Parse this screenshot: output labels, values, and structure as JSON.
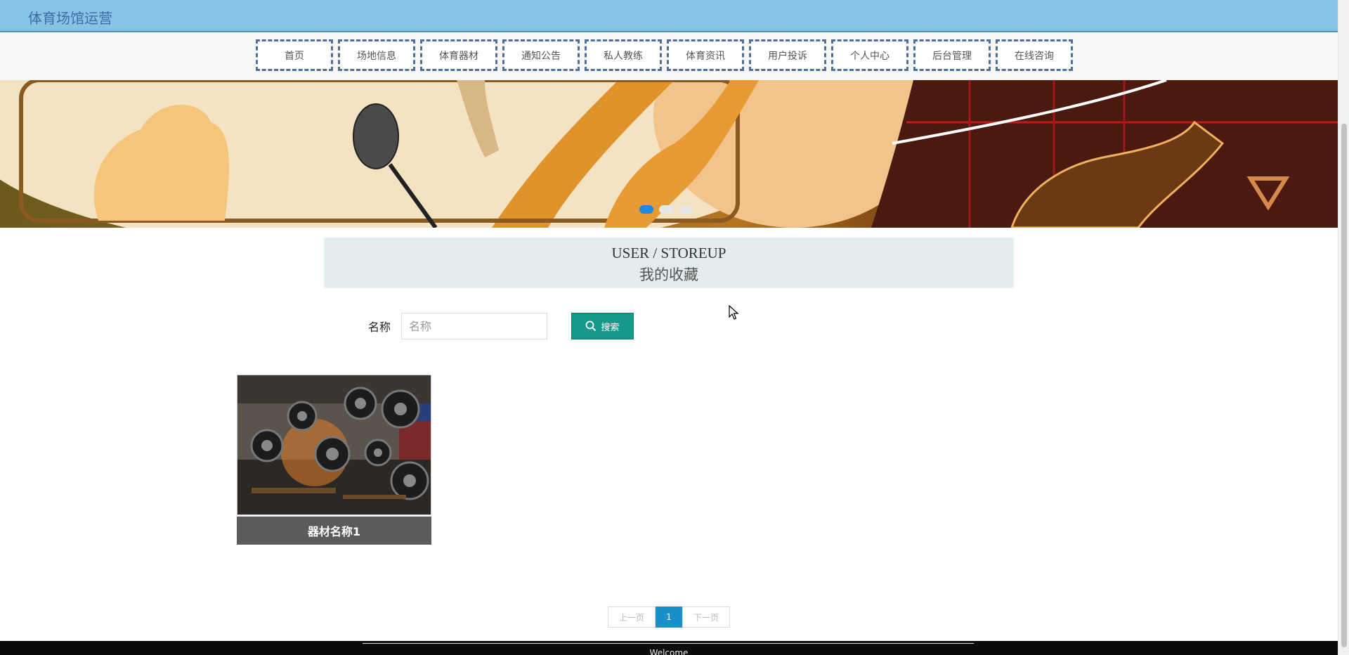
{
  "header": {
    "brand": "体育场馆运营"
  },
  "nav": {
    "items": [
      "首页",
      "场地信息",
      "体育器材",
      "通知公告",
      "私人教练",
      "体育资讯",
      "用户投诉",
      "个人中心",
      "后台管理",
      "在线咨询"
    ]
  },
  "banner": {
    "active_slide": 1,
    "slide_count": 3
  },
  "page_title": {
    "en": "USER / STOREUP",
    "cn": "我的收藏"
  },
  "search": {
    "label": "名称",
    "placeholder": "名称",
    "value": "",
    "button_label": "搜索"
  },
  "cards": [
    {
      "title": "器材名称1"
    }
  ],
  "pagination": {
    "prev": "上一页",
    "current": "1",
    "next": "下一页"
  },
  "footer": {
    "text": "Welcome"
  }
}
